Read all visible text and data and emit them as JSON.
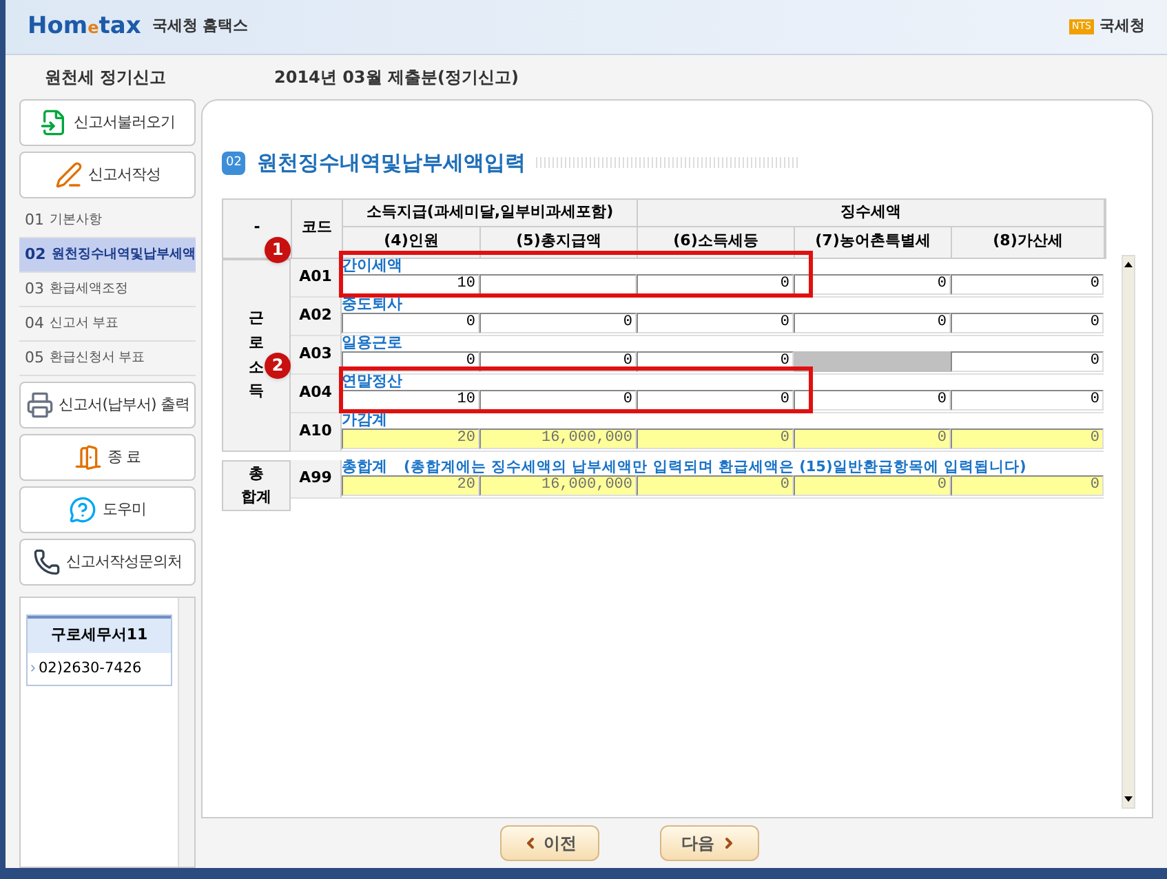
{
  "header": {
    "logo": "Hom",
    "logo_e": "e",
    "logo_tail": "tax",
    "site": "국세청 홈택스",
    "agency_badge": "NTS",
    "agency": "국세청"
  },
  "menu_title": "원천세 정기신고",
  "period_title": "2014년 03월 제출분(정기신고)",
  "sidebar": {
    "top_buttons": [
      {
        "label": "신고서불러오기",
        "kind": "load"
      },
      {
        "label": "신고서작성",
        "kind": "write"
      }
    ],
    "steps": [
      {
        "number": "01",
        "label": "기본사항",
        "selected": false
      },
      {
        "number": "02",
        "label": "원천징수내역및납부세액",
        "selected": true
      },
      {
        "number": "03",
        "label": "환급세액조정",
        "selected": false
      },
      {
        "number": "04",
        "label": "신고서 부표",
        "selected": false
      },
      {
        "number": "05",
        "label": "환급신청서 부표",
        "selected": false
      }
    ],
    "bottom_buttons": [
      {
        "label": "신고서(납부서) 출력",
        "kind": "print"
      },
      {
        "label": "종 료",
        "kind": "exit"
      },
      {
        "label": "도우미",
        "kind": "help"
      },
      {
        "label": "신고서작성문의처",
        "kind": "phone"
      }
    ],
    "office": {
      "name": "구로세무서11",
      "phone": "02)2630-7426"
    }
  },
  "section": {
    "number": "02",
    "title": "원천징수내역및납부세액입력"
  },
  "table": {
    "corner": "-",
    "code_header": "코드",
    "groups_header": [
      {
        "label": "소득지급(과세미달,일부비과세포함)"
      },
      {
        "label": "징수세액"
      }
    ],
    "columns": [
      "(4)인원",
      "(5)총지급액",
      "(6)소득세등",
      "(7)농어촌특별세",
      "(8)가산세"
    ],
    "groups": [
      {
        "label": "근로소득",
        "rows": [
          {
            "code": "A01",
            "label": "간이세액",
            "kind": "input",
            "marker": "1",
            "cells": [
              {
                "value": "10",
                "disabled": false
              },
              {
                "disabled": false
              },
              {
                "value": "0",
                "disabled": false
              },
              {
                "value": "0",
                "disabled": false
              },
              {
                "value": "0",
                "disabled": false
              }
            ]
          },
          {
            "code": "A02",
            "label": "중도퇴사",
            "kind": "input",
            "cells": [
              {
                "value": "0",
                "disabled": false
              },
              {
                "value": "0",
                "disabled": false
              },
              {
                "value": "0",
                "disabled": false
              },
              {
                "value": "0",
                "disabled": false
              },
              {
                "value": "0",
                "disabled": false
              }
            ]
          },
          {
            "code": "A03",
            "label": "일용근로",
            "kind": "input",
            "cells": [
              {
                "value": "0",
                "disabled": false
              },
              {
                "value": "0",
                "disabled": false
              },
              {
                "value": "0",
                "disabled": false
              },
              {
                "disabled": true
              },
              {
                "value": "0",
                "disabled": false
              }
            ]
          },
          {
            "code": "A04",
            "label": "연말정산",
            "kind": "input",
            "marker": "2",
            "cells": [
              {
                "value": "10",
                "disabled": false
              },
              {
                "value": "0",
                "disabled": false
              },
              {
                "value": "0",
                "disabled": false
              },
              {
                "value": "0",
                "disabled": false
              },
              {
                "value": "0",
                "disabled": false
              }
            ]
          },
          {
            "code": "A10",
            "label": "가감계",
            "kind": "total",
            "cells": [
              {
                "value": "20",
                "disabled": false
              },
              {
                "value": "16,000,000",
                "disabled": false
              },
              {
                "value": "0",
                "disabled": false
              },
              {
                "value": "0",
                "disabled": false
              },
              {
                "value": "0",
                "disabled": false
              }
            ]
          }
        ]
      },
      {
        "label": "총 합계",
        "rows": [
          {
            "code": "A99",
            "label": "총합계",
            "note": "(총합계에는 징수세액의 납부세액만 입력되며 환급세액은 (15)일반환급항목에 입력됩니다)",
            "kind": "total",
            "cells": [
              {
                "value": "20",
                "disabled": false
              },
              {
                "value": "16,000,000",
                "disabled": false
              },
              {
                "value": "0",
                "disabled": false
              },
              {
                "value": "0",
                "disabled": false
              },
              {
                "value": "0",
                "disabled": false
              }
            ]
          }
        ]
      }
    ]
  },
  "nav": {
    "prev": "이전",
    "next": "다음"
  }
}
